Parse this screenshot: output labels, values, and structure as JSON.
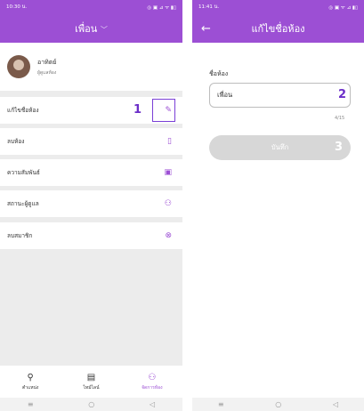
{
  "left": {
    "status": {
      "time": "10:30 น.",
      "icons": "◎ ▣ ⊿ ᯤ ▮▯"
    },
    "header": {
      "title": "เพื่อน",
      "chevron": "chevron-down-icon"
    },
    "profile": {
      "name": "อาทิตย์",
      "role": "ผู้ดูแลห้อง"
    },
    "menu": [
      {
        "label": "แก้ไขชื่อห้อง",
        "icon": "edit-icon",
        "glyph": "✎"
      },
      {
        "label": "ลบห้อง",
        "icon": "trash-icon",
        "glyph": "▯"
      },
      {
        "label": "ความสัมพันธ์",
        "icon": "person-card-icon",
        "glyph": "▣"
      },
      {
        "label": "สถานะผู้ดูแล",
        "icon": "admin-icon",
        "glyph": "⚇"
      },
      {
        "label": "ลบสมาชิก",
        "icon": "remove-circle-icon",
        "glyph": "⊗"
      }
    ],
    "step": "1",
    "nav": [
      {
        "label": "ตำแหน่ง",
        "icon": "location-icon",
        "glyph": "⚲"
      },
      {
        "label": "ไทม์ไลน์",
        "icon": "timeline-icon",
        "glyph": "▤"
      },
      {
        "label": "จัดการห้อง",
        "icon": "group-icon",
        "glyph": "⚇"
      }
    ],
    "sysnav": [
      "≡",
      "○",
      "◁"
    ]
  },
  "right": {
    "status": {
      "time": "11:41 น.",
      "icons": "◎ ▣ ᯤ ⊿ ▮▯"
    },
    "header": {
      "title": "แก้ไขชื่อห้อง",
      "back": "←"
    },
    "field": {
      "label": "ชื่อห้อง",
      "value": "เพื่อน",
      "counter": "4/15"
    },
    "step_field": "2",
    "save": {
      "label": "บันทึก"
    },
    "step_save": "3",
    "sysnav": [
      "≡",
      "○",
      "◁"
    ]
  },
  "colors": {
    "accent": "#9c4fd4",
    "step": "#6b2ec8",
    "disabled": "#d7d7d7"
  }
}
